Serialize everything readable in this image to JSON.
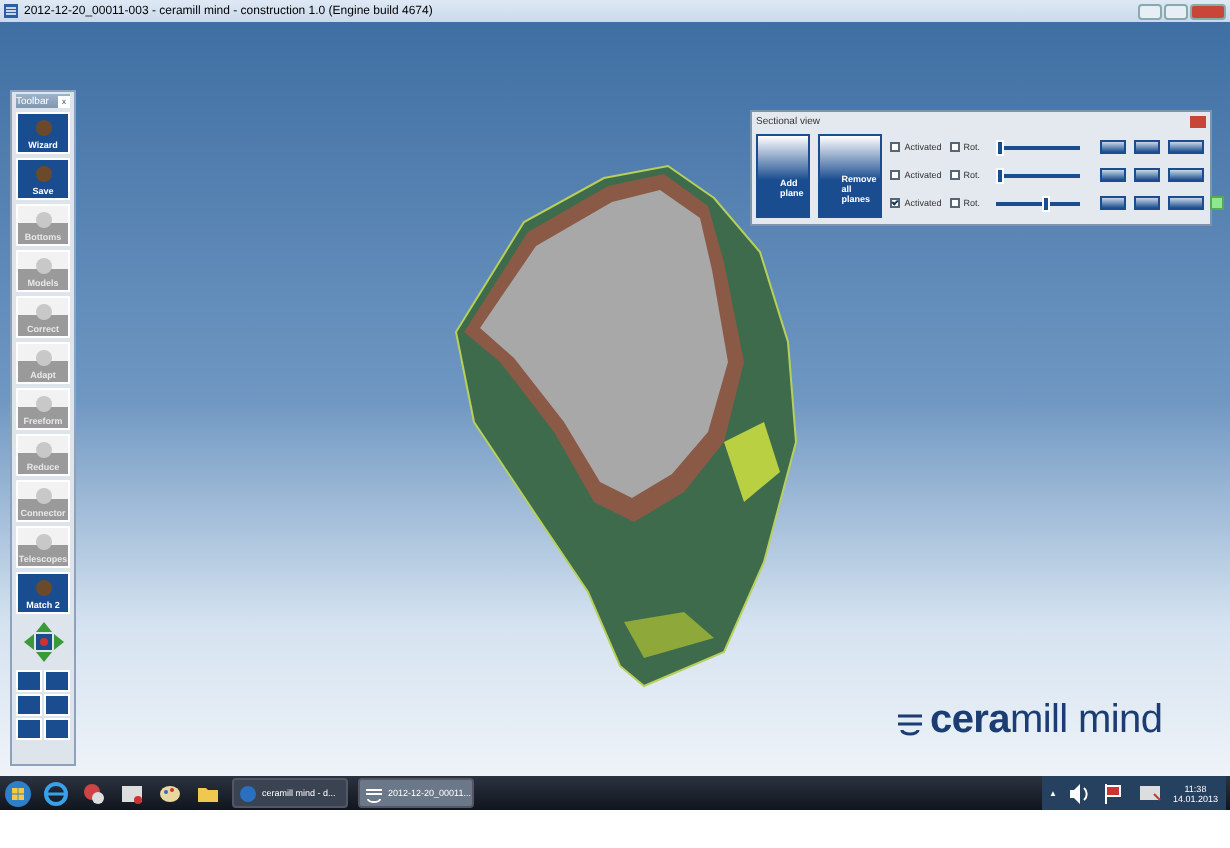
{
  "window": {
    "title": "2012-12-20_00011-003 - ceramill mind - construction 1.0 (Engine build 4674)"
  },
  "toolbar": {
    "title": "Toolbar",
    "close": "x",
    "items": [
      {
        "label": "Wizard",
        "disabled": false
      },
      {
        "label": "Save",
        "disabled": false
      },
      {
        "label": "Bottoms",
        "disabled": true
      },
      {
        "label": "Models",
        "disabled": true
      },
      {
        "label": "Correct",
        "disabled": true
      },
      {
        "label": "Adapt",
        "disabled": true
      },
      {
        "label": "Freeform",
        "disabled": true
      },
      {
        "label": "Reduce",
        "disabled": true
      },
      {
        "label": "Connector",
        "disabled": true
      },
      {
        "label": "Telescopes",
        "disabled": true
      },
      {
        "label": "Match 2",
        "disabled": false
      }
    ]
  },
  "sectional_view": {
    "title": "Sectional view",
    "buttons": [
      {
        "label": "Add plane"
      },
      {
        "label": "Remove all planes"
      }
    ],
    "rows": [
      {
        "activated_label": "Activated",
        "activated": false,
        "rot_label": "Rot.",
        "rot": false,
        "level": 0.0,
        "indicator": false
      },
      {
        "activated_label": "Activated",
        "activated": false,
        "rot_label": "Rot.",
        "rot": false,
        "level": 0.0,
        "indicator": false
      },
      {
        "activated_label": "Activated",
        "activated": true,
        "rot_label": "Rot.",
        "rot": false,
        "level": 0.6,
        "indicator": true
      }
    ]
  },
  "logo": {
    "text": "**cera**mill mind"
  },
  "taskbar": {
    "tasks": [
      {
        "label": "ceramill mind - d...",
        "active": false
      },
      {
        "label": "2012-12-20_00011...",
        "active": true
      }
    ],
    "tray_arrow": "▲",
    "time": "11:38",
    "date": "14.01.2013"
  }
}
